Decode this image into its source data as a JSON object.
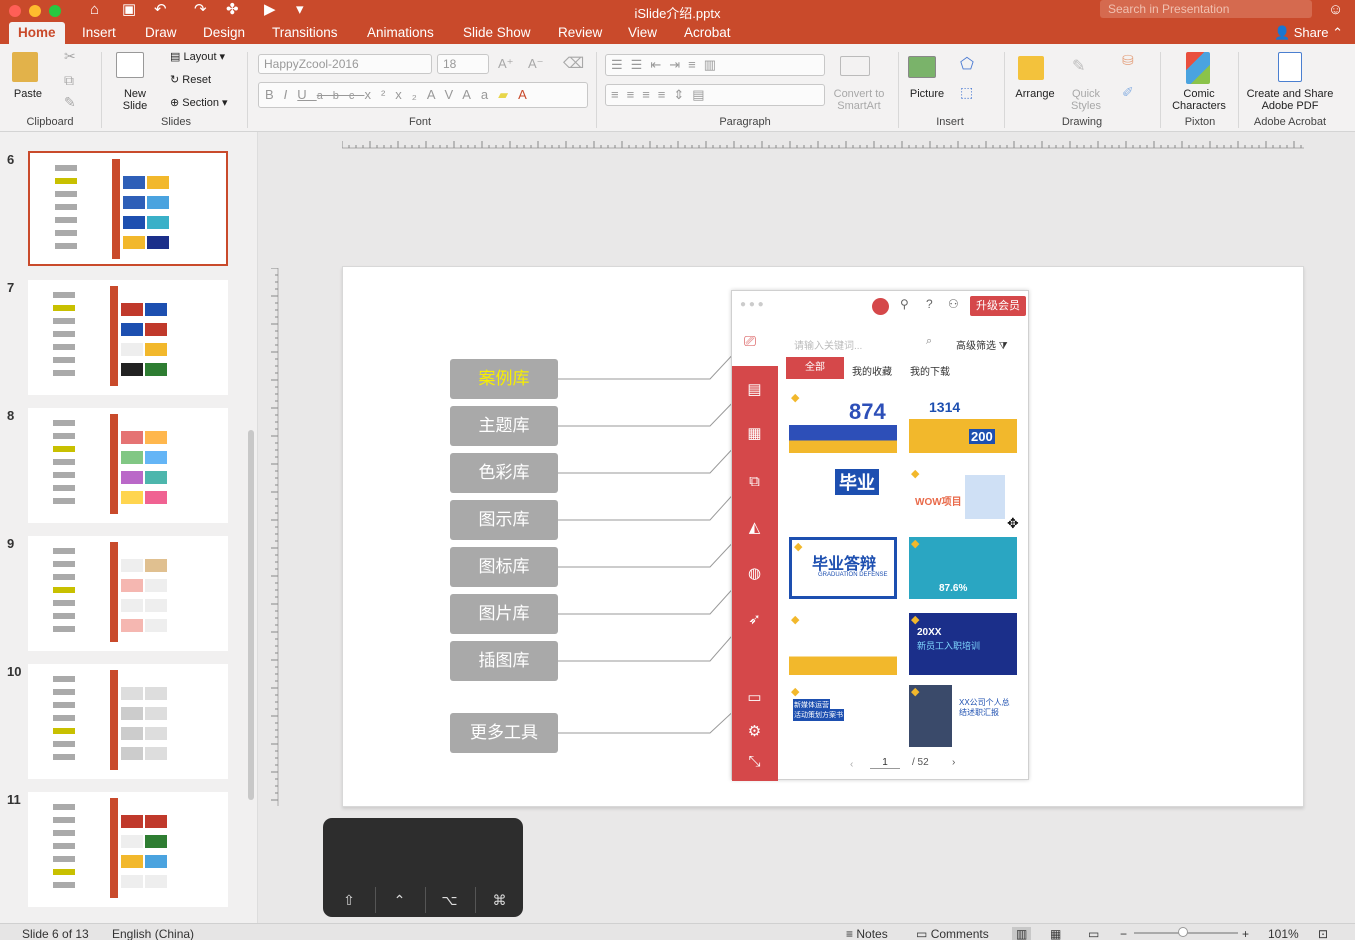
{
  "title_bar": {
    "file_name": "iSlide介绍.pptx",
    "search_placeholder": "Search in Presentation"
  },
  "tabs": [
    {
      "label": "Home",
      "active": true
    },
    {
      "label": "Insert"
    },
    {
      "label": "Draw"
    },
    {
      "label": "Design"
    },
    {
      "label": "Transitions"
    },
    {
      "label": "Animations"
    },
    {
      "label": "Slide Show"
    },
    {
      "label": "Review"
    },
    {
      "label": "View"
    },
    {
      "label": "Acrobat"
    }
  ],
  "share_label": "Share",
  "ribbon": {
    "clipboard": {
      "paste": "Paste",
      "group": "Clipboard"
    },
    "slides": {
      "new_slide_line1": "New",
      "new_slide_line2": "Slide",
      "layout": "Layout",
      "reset": "Reset",
      "section": "Section",
      "group": "Slides"
    },
    "font": {
      "font_name": "HappyZcool-2016",
      "font_size": "18",
      "group": "Font"
    },
    "paragraph": {
      "convert_line1": "Convert to",
      "convert_line2": "SmartArt",
      "group": "Paragraph"
    },
    "insert": {
      "picture": "Picture",
      "group": "Insert"
    },
    "drawing": {
      "arrange": "Arrange",
      "quick_line1": "Quick",
      "quick_line2": "Styles",
      "group": "Drawing"
    },
    "pixton": {
      "comic_line1": "Comic",
      "comic_line2": "Characters",
      "group": "Pixton"
    },
    "acrobat": {
      "create_line1": "Create and Share",
      "create_line2": "Adobe PDF",
      "group": "Adobe Acrobat"
    }
  },
  "thumbnails": [
    {
      "number": "6",
      "selected": true
    },
    {
      "number": "7"
    },
    {
      "number": "8"
    },
    {
      "number": "9"
    },
    {
      "number": "10"
    },
    {
      "number": "11"
    }
  ],
  "slide": {
    "left_buttons": [
      {
        "label": "案例库",
        "highlight": true
      },
      {
        "label": "主题库"
      },
      {
        "label": "色彩库"
      },
      {
        "label": "图示库"
      },
      {
        "label": "图标库"
      },
      {
        "label": "图片库"
      },
      {
        "label": "插图库"
      },
      {
        "label": "更多工具"
      }
    ],
    "panel": {
      "upgrade": "升级会员",
      "search_placeholder": "请输入关键词...",
      "filter": "高级筛选",
      "tabs": [
        "全部",
        "我的收藏",
        "我的下载"
      ],
      "cards": [
        {
          "text": "874"
        },
        {
          "text": "1314",
          "sub": "200"
        },
        {
          "text": "毕业"
        },
        {
          "text": "WOW项目"
        },
        {
          "text": "毕业答辩",
          "sub": "GRADUATION DEFENSE"
        },
        {
          "text": "87.6%"
        },
        {
          "text": ""
        },
        {
          "text": "20XX",
          "sub": "新员工入职培训"
        },
        {
          "text": "新媒体运营",
          "sub": "活动策划方案书"
        },
        {
          "text": "XX公司个人总",
          "sub": "结述职汇报"
        }
      ],
      "pager": {
        "page": "1",
        "total": "/ 52"
      }
    }
  },
  "status_bar": {
    "slide_info": "Slide 6 of 13",
    "language": "English (China)",
    "notes": "Notes",
    "comments": "Comments",
    "zoom": "101%"
  },
  "colors": {
    "accent": "#c94a2b",
    "sidebar_red": "#d5484a",
    "button_gray": "#a9a9a9",
    "highlight_yellow": "#f7ef00"
  }
}
